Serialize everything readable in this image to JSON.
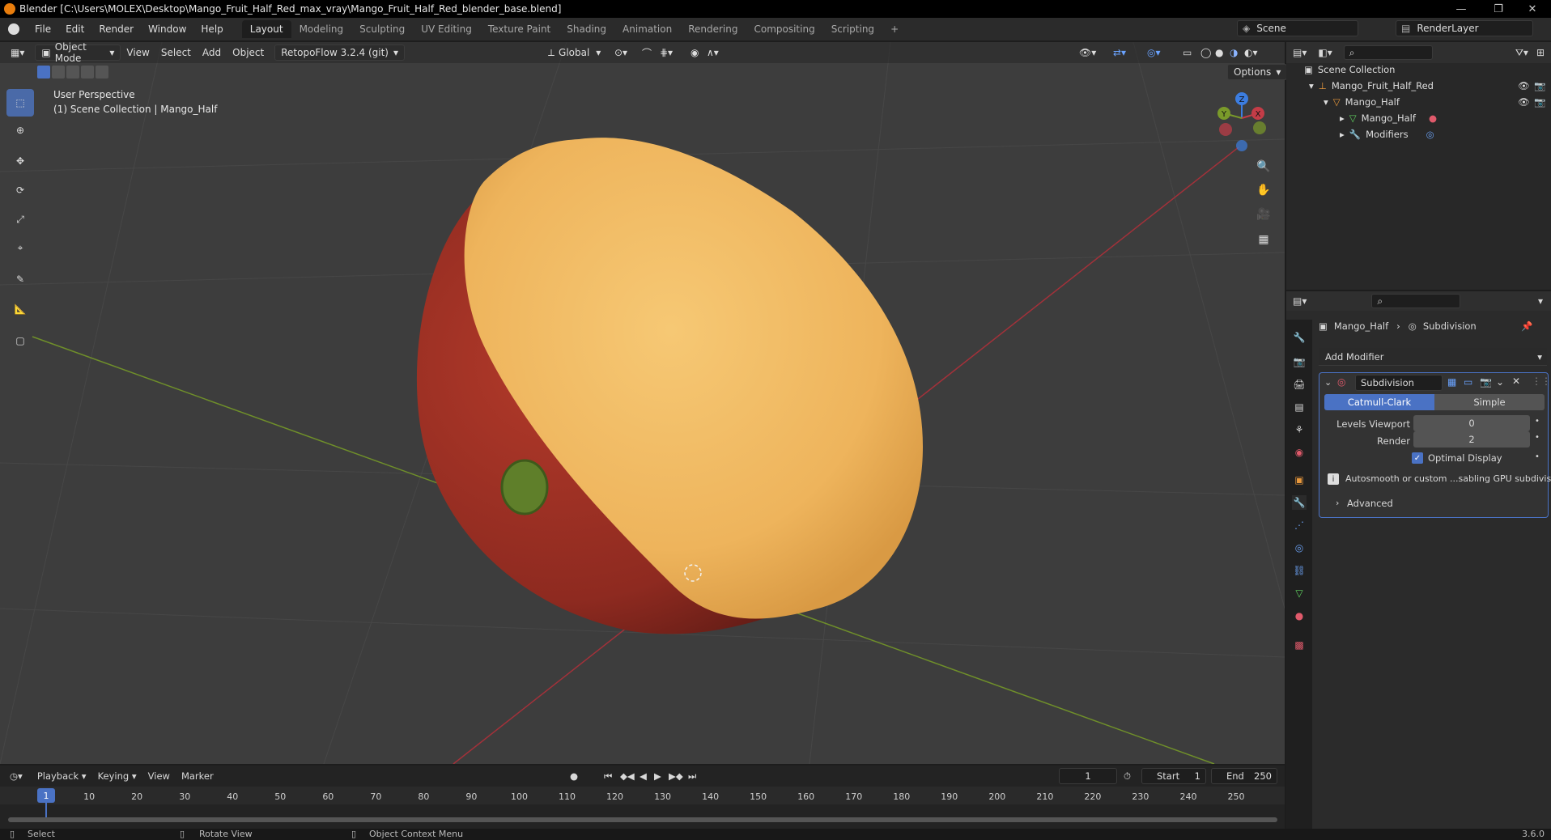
{
  "window": {
    "title": "Blender [C:\\Users\\MOLEX\\Desktop\\Mango_Fruit_Half_Red_max_vray\\Mango_Fruit_Half_Red_blender_base.blend]",
    "controls": [
      "—",
      "❐",
      "✕"
    ]
  },
  "menubar": {
    "items": [
      "File",
      "Edit",
      "Render",
      "Window",
      "Help"
    ],
    "workspaces": [
      "Layout",
      "Modeling",
      "Sculpting",
      "UV Editing",
      "Texture Paint",
      "Shading",
      "Animation",
      "Rendering",
      "Compositing",
      "Scripting"
    ],
    "active_workspace": "Layout",
    "add_workspace": "+",
    "scene": "Scene",
    "view_layer": "RenderLayer"
  },
  "viewport_header": {
    "mode": "Object Mode",
    "menus": [
      "View",
      "Select",
      "Add",
      "Object"
    ],
    "addon": "RetopoFlow 3.2.4 (git)",
    "orientation": "Global",
    "options": "Options"
  },
  "viewport": {
    "perspective": "User Perspective",
    "collection_info": "(1) Scene Collection | Mango_Half",
    "gizmo_axes": [
      "Z",
      "Y",
      "X"
    ]
  },
  "outliner": {
    "root": "Scene Collection",
    "rows": [
      {
        "label": "Mango_Fruit_Half_Red"
      },
      {
        "label": "Mango_Half"
      },
      {
        "label": "Mango_Half"
      },
      {
        "label": "Modifiers"
      }
    ]
  },
  "properties": {
    "breadcrumb_object": "Mango_Half",
    "breadcrumb_modifier": "Subdivision",
    "add_modifier": "Add Modifier",
    "modifier_name": "Subdivision",
    "type_options": [
      "Catmull-Clark",
      "Simple"
    ],
    "active_type": "Catmull-Clark",
    "levels_viewport_label": "Levels Viewport",
    "levels_viewport_value": "0",
    "render_label": "Render",
    "render_value": "2",
    "optimal_display": "Optimal Display",
    "optimal_display_checked": true,
    "info_text": "Autosmooth or custom ...sabling GPU subdivision",
    "advanced": "Advanced"
  },
  "timeline": {
    "menus": [
      "Playback",
      "Keying",
      "View",
      "Marker"
    ],
    "current_frame": "1",
    "start_label": "Start",
    "start_value": "1",
    "end_label": "End",
    "end_value": "250",
    "ticks": [
      "1",
      "10",
      "20",
      "30",
      "40",
      "50",
      "60",
      "70",
      "80",
      "90",
      "100",
      "110",
      "120",
      "130",
      "140",
      "150",
      "160",
      "170",
      "180",
      "190",
      "200",
      "210",
      "220",
      "230",
      "240",
      "250"
    ]
  },
  "statusbar": {
    "select": "Select",
    "rotate": "Rotate View",
    "context": "Object Context Menu",
    "version": "3.6.0"
  },
  "colors": {
    "accent": "#4a72c4",
    "x_axis": "#c33c47",
    "y_axis": "#7a9a2a",
    "z_axis": "#3c7de0",
    "mango_flesh": "#f1c06a",
    "mango_skin": "#9e2f23"
  }
}
